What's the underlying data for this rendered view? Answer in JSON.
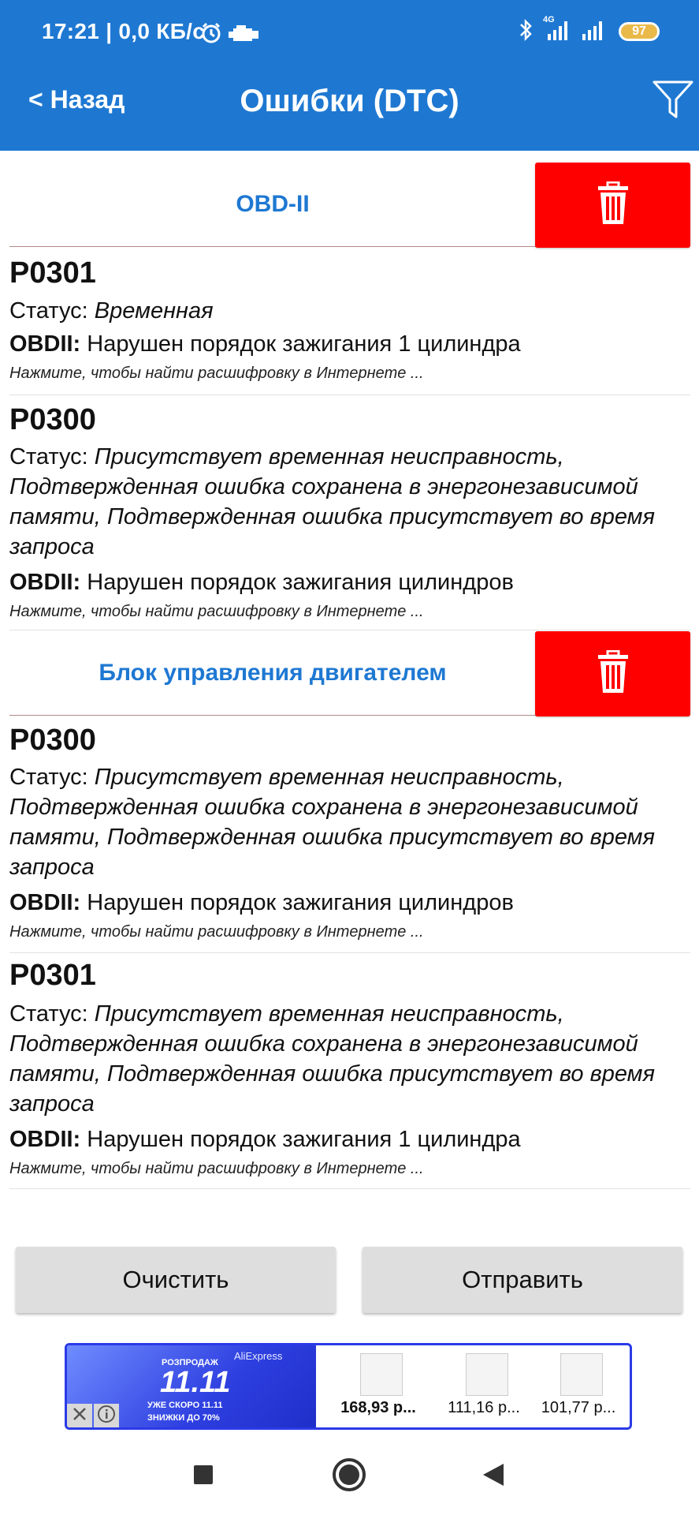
{
  "status_bar": {
    "time": "17:21 | 0,0 КБ/с",
    "network": "4G",
    "battery": "97"
  },
  "header": {
    "back_label": "< Назад",
    "title": "Ошибки (DTC)",
    "filter_icon": "filter-funnel-icon"
  },
  "sections": [
    {
      "title": "OBD-II",
      "delete_icon": "trash-icon",
      "items": [
        {
          "code": "P0301",
          "status_label": "Статус:",
          "status_value": "Временная",
          "obd_label": "OBDII:",
          "description": "Нарушен порядок зажигания 1 цилиндра",
          "hint": "Нажмите, чтобы найти расшифровку в Интернете ..."
        },
        {
          "code": "P0300",
          "status_label": "Статус:",
          "status_value": "Присутствует временная неисправность, Подтвержденная ошибка сохранена в энергонезависимой памяти, Подтвержденная ошибка присутствует во время запроса",
          "obd_label": "OBDII:",
          "description": "Нарушен порядок зажигания цилиндров",
          "hint": "Нажмите, чтобы найти расшифровку в Интернете ..."
        }
      ]
    },
    {
      "title": "Блок управления двигателем",
      "delete_icon": "trash-icon",
      "items": [
        {
          "code": "P0300",
          "status_label": "Статус:",
          "status_value": "Присутствует временная неисправность, Подтвержденная ошибка сохранена в энергонезависимой памяти, Подтвержденная ошибка присутствует во время запроса",
          "obd_label": "OBDII:",
          "description": "Нарушен порядок зажигания цилиндров",
          "hint": "Нажмите, чтобы найти расшифровку в Интернете ..."
        },
        {
          "code": "P0301",
          "status_label": "Статус:",
          "status_value": "Присутствует временная неисправность, Подтвержденная ошибка сохранена в энергонезависимой памяти, Подтвержденная ошибка присутствует во время запроса",
          "obd_label": "OBDII:",
          "description": "Нарушен порядок зажигания 1 цилиндра",
          "hint": "Нажмите, чтобы найти расшифровку в Интернете ..."
        }
      ]
    }
  ],
  "actions": {
    "clear_label": "Очистить",
    "send_label": "Отправить"
  },
  "ad": {
    "brand": "AliExpress",
    "sale_label": "РОЗПРОДАЖ",
    "big_text": "11.11",
    "sub_line1": "УЖЕ СКОРО 11.11",
    "sub_line2": "ЗНИЖКИ ДО 70%",
    "products": [
      {
        "price": "168,93 р..."
      },
      {
        "price": "111,16 р..."
      },
      {
        "price": "101,77 р..."
      }
    ]
  },
  "colors": {
    "primary": "#1e78d2",
    "danger": "#ff0000",
    "button_gray": "#dedede"
  }
}
